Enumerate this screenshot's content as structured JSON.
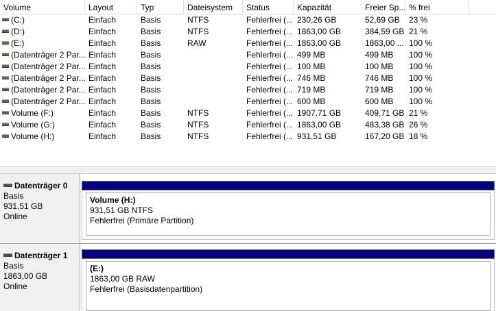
{
  "columns": [
    "Volume",
    "Layout",
    "Typ",
    "Dateisystem",
    "Status",
    "Kapazität",
    "Freier Sp...",
    "% frei",
    ""
  ],
  "volumes": [
    {
      "volume": "(C:)",
      "layout": "Einfach",
      "typ": "Basis",
      "fs": "NTFS",
      "status": "Fehlerfrei (...",
      "kapazitaet": "230,26 GB",
      "frei": "52,69 GB",
      "prozent": "23 %"
    },
    {
      "volume": "(D:)",
      "layout": "Einfach",
      "typ": "Basis",
      "fs": "NTFS",
      "status": "Fehlerfrei (...",
      "kapazitaet": "1863,00 GB",
      "frei": "384,59 GB",
      "prozent": "21 %"
    },
    {
      "volume": "(E:)",
      "layout": "Einfach",
      "typ": "Basis",
      "fs": "RAW",
      "status": "Fehlerfrei (...",
      "kapazitaet": "1863,00 GB",
      "frei": "1863,00 ...",
      "prozent": "100 %"
    },
    {
      "volume": "(Datenträger 2 Par...",
      "layout": "Einfach",
      "typ": "Basis",
      "fs": "",
      "status": "Fehlerfrei (...",
      "kapazitaet": "499 MB",
      "frei": "499 MB",
      "prozent": "100 %"
    },
    {
      "volume": "(Datenträger 2 Par...",
      "layout": "Einfach",
      "typ": "Basis",
      "fs": "",
      "status": "Fehlerfrei (...",
      "kapazitaet": "100 MB",
      "frei": "100 MB",
      "prozent": "100 %"
    },
    {
      "volume": "(Datenträger 2 Par...",
      "layout": "Einfach",
      "typ": "Basis",
      "fs": "",
      "status": "Fehlerfrei (...",
      "kapazitaet": "746 MB",
      "frei": "746 MB",
      "prozent": "100 %"
    },
    {
      "volume": "(Datenträger 2 Par...",
      "layout": "Einfach",
      "typ": "Basis",
      "fs": "",
      "status": "Fehlerfrei (...",
      "kapazitaet": "719 MB",
      "frei": "719 MB",
      "prozent": "100 %"
    },
    {
      "volume": "(Datenträger 2 Par...",
      "layout": "Einfach",
      "typ": "Basis",
      "fs": "",
      "status": "Fehlerfrei (...",
      "kapazitaet": "600 MB",
      "frei": "600 MB",
      "prozent": "100 %"
    },
    {
      "volume": "Volume (F:)",
      "layout": "Einfach",
      "typ": "Basis",
      "fs": "NTFS",
      "status": "Fehlerfrei (...",
      "kapazitaet": "1907,71 GB",
      "frei": "409,71 GB",
      "prozent": "21 %"
    },
    {
      "volume": "Volume (G:)",
      "layout": "Einfach",
      "typ": "Basis",
      "fs": "NTFS",
      "status": "Fehlerfrei (...",
      "kapazitaet": "1863,00 GB",
      "frei": "483,38 GB",
      "prozent": "26 %"
    },
    {
      "volume": "Volume (H:)",
      "layout": "Einfach",
      "typ": "Basis",
      "fs": "NTFS",
      "status": "Fehlerfrei (...",
      "kapazitaet": "931,51 GB",
      "frei": "167,20 GB",
      "prozent": "18 %"
    }
  ],
  "disks": [
    {
      "name": "Datenträger 0",
      "type": "Basis",
      "size": "931,51 GB",
      "state": "Online",
      "partition": {
        "name": "Volume  (H:)",
        "detail": "931,51 GB NTFS",
        "status": "Fehlerfrei (Primäre Partition)"
      }
    },
    {
      "name": "Datenträger 1",
      "type": "Basis",
      "size": "1863,00 GB",
      "state": "Online",
      "partition": {
        "name": "(E:)",
        "detail": "1863,00 GB RAW",
        "status": "Fehlerfrei (Basisdatenpartition)"
      }
    }
  ],
  "colors": {
    "partition_bar": "#000080",
    "label_bg": "#f0f0f0"
  },
  "icons": {
    "volume": "drive-icon",
    "disk": "disk-icon"
  }
}
